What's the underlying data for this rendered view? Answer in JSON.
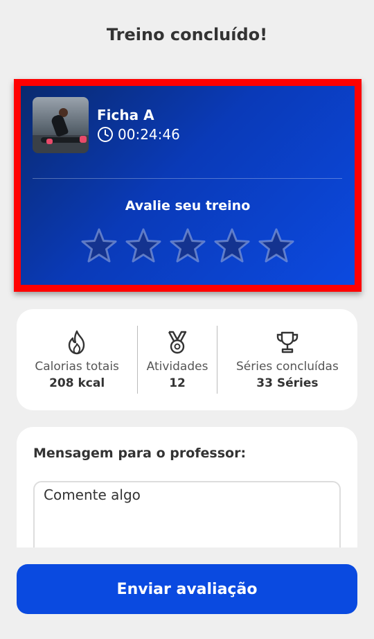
{
  "header": {
    "title": "Treino concluído!"
  },
  "workout": {
    "name": "Ficha A",
    "duration": "00:24:46",
    "rating_title": "Avalie seu treino",
    "rating_max": 5,
    "rating_value": 0
  },
  "stats": [
    {
      "icon": "flame-icon",
      "label": "Calorias totais",
      "value": "208 kcal"
    },
    {
      "icon": "medal-icon",
      "label": "Atividades",
      "value": "12"
    },
    {
      "icon": "trophy-icon",
      "label": "Séries concluídas",
      "value": "33 Séries"
    }
  ],
  "message": {
    "label": "Mensagem para o professor:",
    "placeholder": "Comente algo"
  },
  "actions": {
    "submit_label": "Enviar avaliação"
  },
  "colors": {
    "accent": "#0a4ae0",
    "highlight_border": "#ff0000",
    "background": "#efefef"
  }
}
